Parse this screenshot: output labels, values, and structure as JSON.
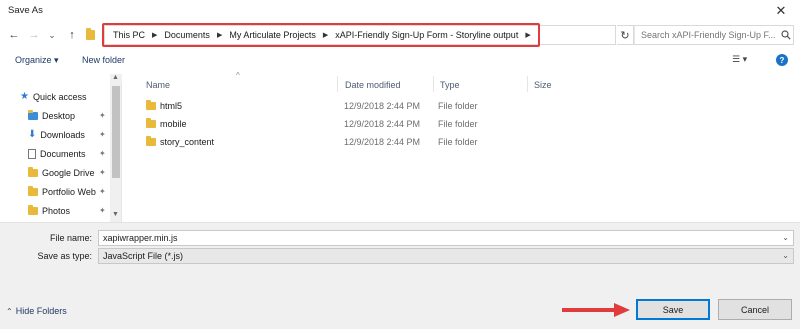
{
  "window": {
    "title": "Save As",
    "close_glyph": "✕"
  },
  "nav": {
    "back_glyph": "←",
    "forward_glyph": "→",
    "recent_glyph": "⌄",
    "up_glyph": "↑"
  },
  "breadcrumb": {
    "items": [
      "This PC",
      "Documents",
      "My Articulate Projects",
      "xAPI-Friendly Sign-Up Form - Storyline output"
    ],
    "separator": "▶",
    "highlight_color": "#e03c3c"
  },
  "refresh_glyph": "↻",
  "search": {
    "placeholder": "Search xAPI-Friendly Sign-Up F...",
    "icon": "search-icon"
  },
  "toolbar": {
    "organize_label": "Organize ▾",
    "new_folder_label": "New folder",
    "view_glyph": "☰ ▾",
    "help_glyph": "?"
  },
  "sidebar": {
    "items": [
      {
        "label": "Quick access",
        "icon": "star-icon",
        "pinned": false
      },
      {
        "label": "Desktop",
        "icon": "desktop-icon",
        "pinned": true
      },
      {
        "label": "Downloads",
        "icon": "download-icon",
        "pinned": true
      },
      {
        "label": "Documents",
        "icon": "documents-icon",
        "pinned": true
      },
      {
        "label": "Google Drive",
        "icon": "google-drive-icon",
        "pinned": true
      },
      {
        "label": "Portfolio Web",
        "icon": "folder-icon",
        "pinned": true
      },
      {
        "label": "Photos",
        "icon": "folder-icon",
        "pinned": true
      }
    ],
    "pin_glyph": "📌"
  },
  "filelist": {
    "columns": [
      "Name",
      "Date modified",
      "Type",
      "Size"
    ],
    "sort_glyph": "^",
    "rows": [
      {
        "name": "html5",
        "date": "12/9/2018 2:44 PM",
        "type": "File folder",
        "size": ""
      },
      {
        "name": "mobile",
        "date": "12/9/2018 2:44 PM",
        "type": "File folder",
        "size": ""
      },
      {
        "name": "story_content",
        "date": "12/9/2018 2:44 PM",
        "type": "File folder",
        "size": ""
      }
    ]
  },
  "form": {
    "file_name_label": "File name:",
    "file_name_value": "xapiwrapper.min.js",
    "save_type_label": "Save as type:",
    "save_type_value": "JavaScript File (*.js)"
  },
  "footer": {
    "hide_folders_label": "Hide Folders",
    "hide_folders_glyph": "⌃",
    "save_label": "Save",
    "cancel_label": "Cancel"
  },
  "colors": {
    "accent": "#0078d7",
    "annotation_red": "#e03c3c",
    "folder": "#e8b93b"
  }
}
